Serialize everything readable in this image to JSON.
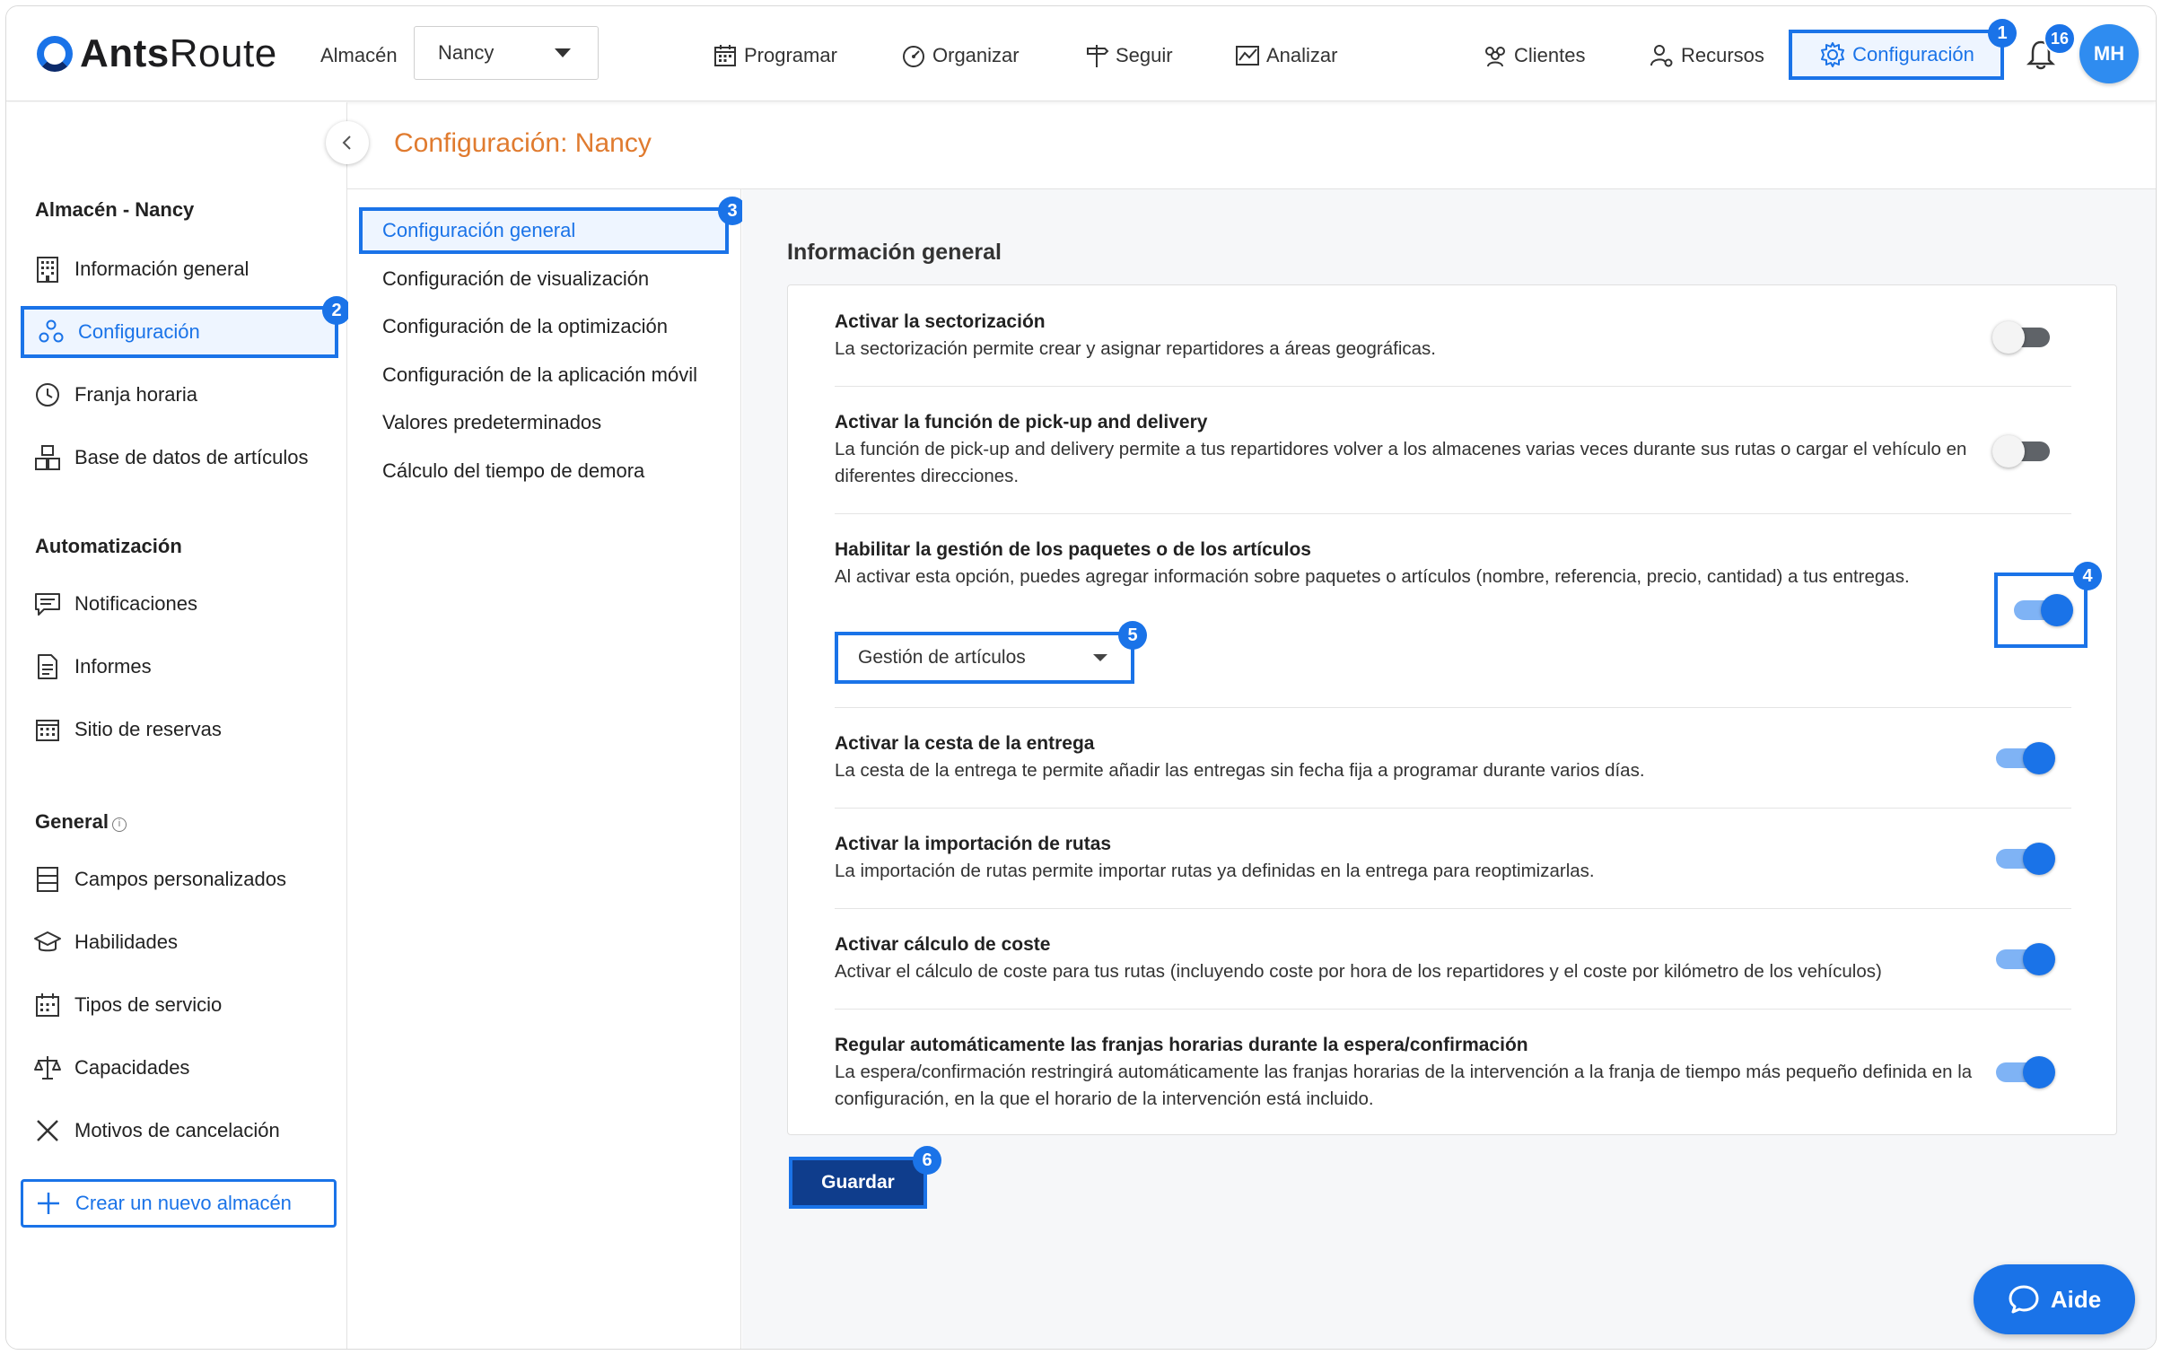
{
  "app": {
    "logo_bold": "Ants",
    "logo_thin": "Route"
  },
  "header": {
    "warehouse_label": "Almacén",
    "warehouse_value": "Nancy",
    "nav": [
      {
        "label": "Programar",
        "icon": "calendar-icon"
      },
      {
        "label": "Organizar",
        "icon": "gauge-icon"
      },
      {
        "label": "Seguir",
        "icon": "signpost-icon"
      },
      {
        "label": "Analizar",
        "icon": "chart-icon"
      },
      {
        "label": "Clientes",
        "icon": "users-icon"
      },
      {
        "label": "Recursos",
        "icon": "user-gear-icon"
      }
    ],
    "config_label": "Configuración",
    "notification_count": "16",
    "avatar_initials": "MH"
  },
  "badges": {
    "b1": "1",
    "b2": "2",
    "b3": "3",
    "b4": "4",
    "b5": "5",
    "b6": "6"
  },
  "sidebar": {
    "section_warehouse": "Almacén - Nancy",
    "section_automation": "Automatización",
    "section_general": "General",
    "items": [
      {
        "label": "Información general",
        "icon": "building-icon"
      },
      {
        "label": "Configuración",
        "icon": "settings-nodes-icon"
      },
      {
        "label": "Franja horaria",
        "icon": "clock-icon"
      },
      {
        "label": "Base de datos de artículos",
        "icon": "boxes-icon"
      },
      {
        "label": "Notificaciones",
        "icon": "message-icon"
      },
      {
        "label": "Informes",
        "icon": "document-icon"
      },
      {
        "label": "Sitio de reservas",
        "icon": "calendar-grid-icon"
      },
      {
        "label": "Campos personalizados",
        "icon": "form-fields-icon"
      },
      {
        "label": "Habilidades",
        "icon": "graduation-cap-icon"
      },
      {
        "label": "Tipos de servicio",
        "icon": "service-types-icon"
      },
      {
        "label": "Capacidades",
        "icon": "scale-icon"
      },
      {
        "label": "Motivos de cancelación",
        "icon": "x-icon"
      }
    ],
    "new_warehouse": "Crear un nuevo almacén"
  },
  "page": {
    "title": "Configuración: Nancy"
  },
  "submenu": [
    "Configuración general",
    "Configuración de visualización",
    "Configuración de la optimización",
    "Configuración de la aplicación móvil",
    "Valores predeterminados",
    "Cálculo del tiempo de demora"
  ],
  "main": {
    "section_title": "Información general",
    "settings": [
      {
        "title": "Activar la sectorización",
        "desc": "La sectorización permite crear y asignar repartidores a áreas geográficas.",
        "enabled": false
      },
      {
        "title": "Activar la función de pick-up and delivery",
        "desc": "La función de pick-up and delivery permite a tus repartidores volver a los almacenes varias veces durante sus rutas o cargar el vehículo en diferentes direcciones.",
        "enabled": false
      },
      {
        "title": "Habilitar la gestión de los paquetes o de los artículos",
        "desc": "Al activar esta opción, puedes agregar información sobre paquetes o artículos (nombre, referencia, precio, cantidad) a tus entregas.",
        "enabled": true
      },
      {
        "title": "Activar la cesta de la entrega",
        "desc": "La cesta de la entrega te permite añadir las entregas sin fecha fija a programar durante varios días.",
        "enabled": true
      },
      {
        "title": "Activar la importación de rutas",
        "desc": "La importación de rutas permite importar rutas ya definidas en la entrega para reoptimizarlas.",
        "enabled": true
      },
      {
        "title": "Activar cálculo de coste",
        "desc": "Activar el cálculo de coste para tus rutas (incluyendo coste por hora de los repartidores y el coste por kilómetro de los vehículos)",
        "enabled": true
      },
      {
        "title": "Regular automáticamente las franjas horarias durante la espera/confirmación",
        "desc": "La espera/confirmación restringirá automáticamente las franjas horarias de la intervención a la franja de tiempo más pequeño definida en la configuración, en la que el horario de la intervención está incluido.",
        "enabled": true
      }
    ],
    "dropdown_value": "Gestión de artículos",
    "save_label": "Guardar",
    "help_label": "Aide"
  },
  "colors": {
    "accent": "#1a73e8",
    "title_orange": "#e07b2f",
    "save_bg": "#0f3d8c"
  }
}
